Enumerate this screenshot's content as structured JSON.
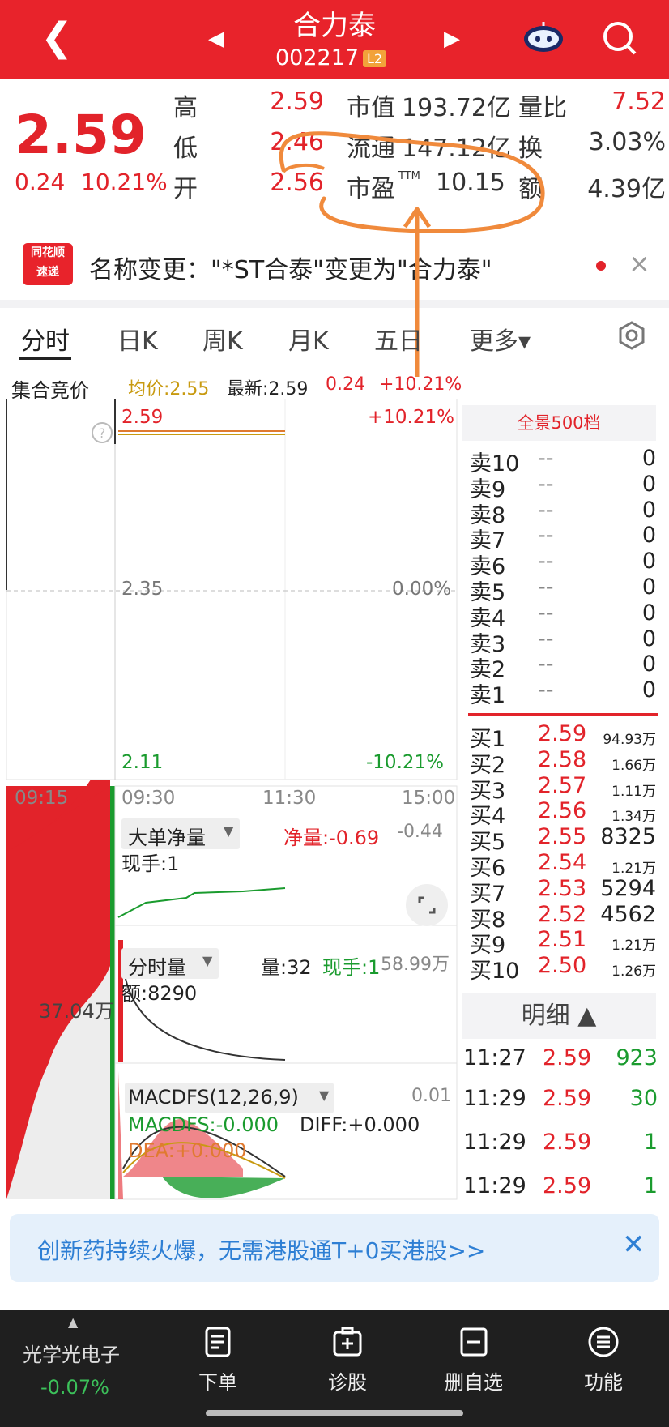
{
  "header": {
    "stock_name": "合力泰",
    "stock_code": "002217",
    "level_badge": "L2",
    "back_icon": "chevron-left-icon",
    "prev_icon": "triangle-left-icon",
    "next_icon": "triangle-right-icon",
    "assistant_icon": "robot-icon",
    "search_icon": "search-icon"
  },
  "quote": {
    "price": "2.59",
    "change": "0.24",
    "change_pct": "10.21%",
    "high_label": "高",
    "high": "2.59",
    "low_label": "低",
    "low": "2.46",
    "open_label": "开",
    "open": "2.56",
    "mcap_label": "市值",
    "mcap": "193.72亿",
    "float_label": "流通",
    "float": "147.12亿",
    "pe_label": "市盈",
    "pe_sup": "TTM",
    "pe": "10.15",
    "vol_ratio_label": "量比",
    "vol_ratio": "7.52",
    "turnover_label": "换",
    "turnover": "3.03%",
    "amount_label": "额",
    "amount": "4.39亿"
  },
  "news": {
    "logo_line1": "同花顺",
    "logo_line2": "速递",
    "text": "名称变更：\"*ST合泰\"变更为\"合力泰\"",
    "close_icon": "close-icon"
  },
  "tabs": {
    "items": [
      "分时",
      "日K",
      "周K",
      "月K",
      "五日",
      "更多▾"
    ],
    "settings_icon": "settings-icon"
  },
  "chart_header": {
    "auction_label": "集合竞价",
    "avg": "均价:2.55",
    "latest": "最新:2.59",
    "change": "0.24",
    "change_pct": "+10.21%"
  },
  "chart_data": {
    "type": "line",
    "title": "",
    "xlabel": "",
    "ylabel": "",
    "x_ticks": [
      "09:15",
      "09:30",
      "11:30",
      "15:00"
    ],
    "y_left_ticks": [
      "2.59",
      "2.35",
      "2.11"
    ],
    "y_right_ticks": [
      "+10.21%",
      "0.00%",
      "-10.21%"
    ],
    "ylim": [
      2.11,
      2.59
    ],
    "series": [
      {
        "values": [
          2.59,
          2.59,
          2.59,
          2.59
        ]
      }
    ],
    "auction_volume_label": "37.04万"
  },
  "indicators": {
    "big_order_label": "大单净量",
    "big_order_net": "净量:-0.69",
    "big_order_axis": "-0.44",
    "big_order_hand": "现手:1",
    "vol_label": "分时量",
    "vol_amount": "量:32",
    "vol_hand": "现手:1",
    "vol_axis": "58.99万",
    "vol_money": "额:8290",
    "macd_label": "MACDFS(12,26,9)",
    "macd_axis": "0.01",
    "macd_value": "MACDFS:-0.000",
    "diff_value": "DIFF:+0.000",
    "dea_value": "DEA:+0.000"
  },
  "order_book": {
    "title": "全景500档",
    "asks": [
      {
        "name": "卖10",
        "price": "--",
        "vol": "0"
      },
      {
        "name": "卖9",
        "price": "--",
        "vol": "0"
      },
      {
        "name": "卖8",
        "price": "--",
        "vol": "0"
      },
      {
        "name": "卖7",
        "price": "--",
        "vol": "0"
      },
      {
        "name": "卖6",
        "price": "--",
        "vol": "0"
      },
      {
        "name": "卖5",
        "price": "--",
        "vol": "0"
      },
      {
        "name": "卖4",
        "price": "--",
        "vol": "0"
      },
      {
        "name": "卖3",
        "price": "--",
        "vol": "0"
      },
      {
        "name": "卖2",
        "price": "--",
        "vol": "0"
      },
      {
        "name": "卖1",
        "price": "--",
        "vol": "0"
      }
    ],
    "bids": [
      {
        "name": "买1",
        "price": "2.59",
        "vol": "94.93万"
      },
      {
        "name": "买2",
        "price": "2.58",
        "vol": "1.66万"
      },
      {
        "name": "买3",
        "price": "2.57",
        "vol": "1.11万"
      },
      {
        "name": "买4",
        "price": "2.56",
        "vol": "1.34万"
      },
      {
        "name": "买5",
        "price": "2.55",
        "vol": "8325"
      },
      {
        "name": "买6",
        "price": "2.54",
        "vol": "1.21万"
      },
      {
        "name": "买7",
        "price": "2.53",
        "vol": "5294"
      },
      {
        "name": "买8",
        "price": "2.52",
        "vol": "4562"
      },
      {
        "name": "买9",
        "price": "2.51",
        "vol": "1.21万"
      },
      {
        "name": "买10",
        "price": "2.50",
        "vol": "1.26万"
      }
    ]
  },
  "trade_detail": {
    "title": "明细 ▲",
    "rows": [
      {
        "time": "11:27",
        "price": "2.59",
        "vol": "923"
      },
      {
        "time": "11:29",
        "price": "2.59",
        "vol": "30"
      },
      {
        "time": "11:29",
        "price": "2.59",
        "vol": "1"
      },
      {
        "time": "11:29",
        "price": "2.59",
        "vol": "1"
      }
    ]
  },
  "promo": {
    "text": "创新药持续火爆，无需港股通T+0买港股>>",
    "close_icon": "close-icon"
  },
  "bottom_bar": {
    "sector_name": "光学光电子",
    "sector_change": "-0.07%",
    "items": [
      {
        "label": "下单",
        "icon": "order-icon"
      },
      {
        "label": "诊股",
        "icon": "diagnose-icon"
      },
      {
        "label": "删自选",
        "icon": "remove-watchlist-icon"
      },
      {
        "label": "功能",
        "icon": "menu-icon"
      }
    ]
  },
  "colors": {
    "brand_red": "#e8232b",
    "up_red": "#e2232a",
    "down_green": "#1a9b2e",
    "annotation_orange": "#f08a3c",
    "promo_blue": "#2e7fd4"
  }
}
